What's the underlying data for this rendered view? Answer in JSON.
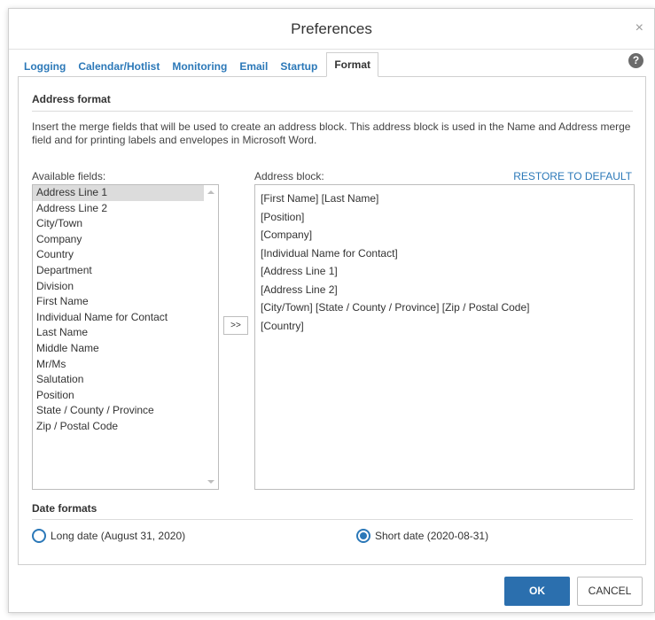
{
  "dialog": {
    "title": "Preferences",
    "close_glyph": "×",
    "help_glyph": "?"
  },
  "tabs": [
    {
      "label": "Logging",
      "active": false
    },
    {
      "label": "Calendar/Hotlist",
      "active": false
    },
    {
      "label": "Monitoring",
      "active": false
    },
    {
      "label": "Email",
      "active": false
    },
    {
      "label": "Startup",
      "active": false
    },
    {
      "label": "Format",
      "active": true
    }
  ],
  "address_format": {
    "title": "Address format",
    "description": "Insert the merge fields that will be used to create an address block. This address block is used in the Name and Address merge field and for printing labels and envelopes in Microsoft Word.",
    "available_label": "Available fields:",
    "address_block_label": "Address block:",
    "restore_label": "RESTORE TO DEFAULT",
    "add_button_label": ">>",
    "available_fields": [
      "Address Line 1",
      "Address Line 2",
      "City/Town",
      "Company",
      "Country",
      "Department",
      "Division",
      "First Name",
      "Individual Name for Contact",
      "Last Name",
      "Middle Name",
      "Mr/Ms",
      "Salutation",
      "Position",
      "State / County / Province",
      "Zip / Postal Code"
    ],
    "selected_field": "Address Line 1",
    "address_block_lines": [
      "[First Name] [Last Name]",
      "[Position]",
      "[Company]",
      "[Individual Name for Contact]",
      "[Address Line 1]",
      "[Address Line 2]",
      "[City/Town] [State / County / Province]  [Zip / Postal Code]",
      "[Country]"
    ]
  },
  "date_formats": {
    "title": "Date formats",
    "long_label": "Long date (August 31, 2020)",
    "short_label": "Short date (2020-08-31)",
    "selected": "short"
  },
  "footer": {
    "ok_label": "OK",
    "cancel_label": "CANCEL"
  },
  "colors": {
    "accent": "#2b78b8",
    "primary_button": "#2b6fae",
    "selected_row": "#dcdcdc"
  }
}
